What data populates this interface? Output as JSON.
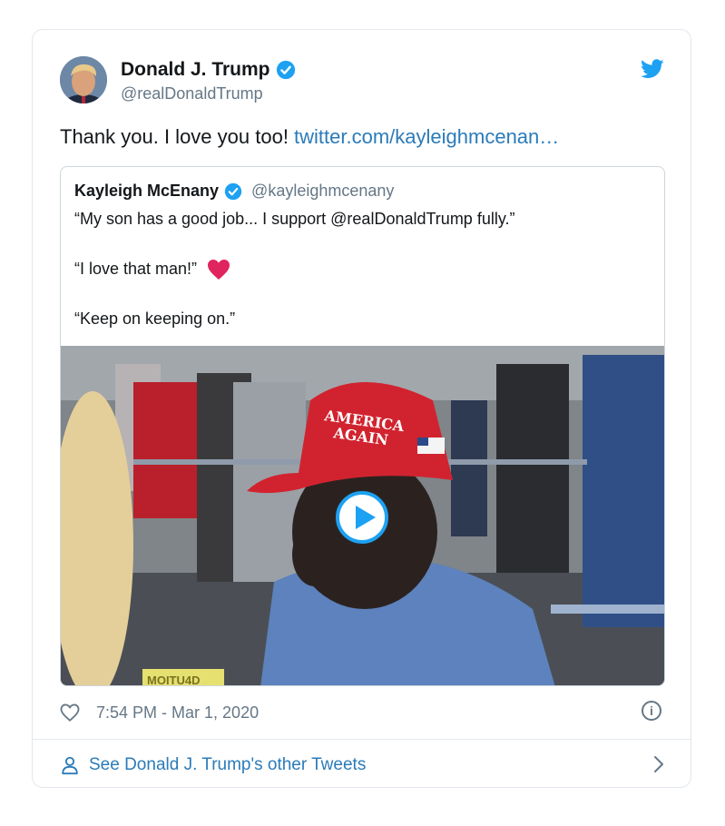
{
  "tweet": {
    "author_name": "Donald J. Trump",
    "author_handle": "@realDonaldTrump",
    "text": "Thank you. I love you too! ",
    "link": "twitter.com/kayleighmcenan…",
    "timestamp": "7:54 PM - Mar 1, 2020"
  },
  "quoted": {
    "author_name": "Kayleigh McEnany",
    "author_handle": "@kayleighmcenany",
    "line1": "“My son has a good job... I support @realDonaldTrump fully.”",
    "line2": "“I love that man!”",
    "line3": "“Keep on keeping on.”",
    "video_hat_text": [
      "AMERICA",
      "AGAIN"
    ],
    "video_sign_text": "MOITU4D"
  },
  "footer": {
    "see_more_label": "See Donald J. Trump's other Tweets"
  },
  "colors": {
    "twitter_blue": "#1da1f2",
    "link_blue": "#2b7bb9",
    "muted_gray": "#657786",
    "heart_red": "#e0245e"
  },
  "icons": {
    "verified": "verified-badge-icon",
    "brand": "twitter-bird-icon",
    "heart": "heart-emoji-icon",
    "like": "like-heart-outline-icon",
    "info": "info-icon",
    "person": "person-icon",
    "chevron": "chevron-right-icon",
    "play": "play-icon"
  }
}
